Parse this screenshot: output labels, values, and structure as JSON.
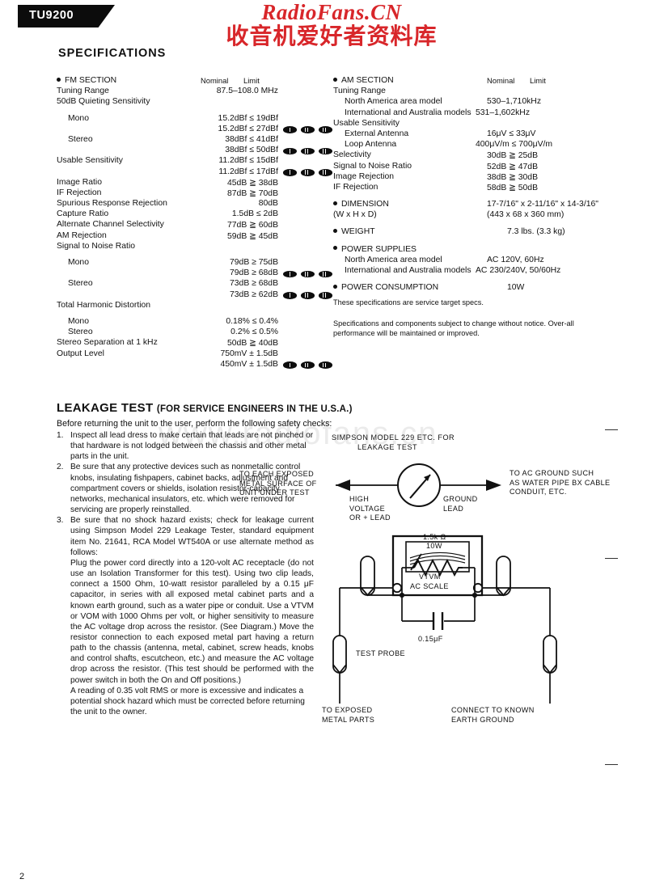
{
  "header": {
    "model": "TU9200",
    "watermark_line1": "RadioFans.CN",
    "watermark_line2": "收音机爱好者资料库",
    "watermark_faint": "www.radiofans.cn"
  },
  "spec_title": "SPECIFICATIONS",
  "fm": {
    "section_label": "FM SECTION",
    "col_nominal": "Nominal",
    "col_limit": "Limit",
    "rows": [
      {
        "label": "Tuning Range",
        "indent": 0,
        "value": "87.5–108.0 MHz",
        "badges": false
      },
      {
        "label": "50dB Quieting Sensitivity",
        "indent": 0,
        "value": "",
        "badges": false
      },
      {
        "label": "Mono",
        "indent": 1,
        "value": "15.2dBf ≤ 19dBf",
        "badges": false
      },
      {
        "label": "",
        "indent": 1,
        "value": "15.2dBf ≤ 27dBf",
        "badges": true
      },
      {
        "label": "Stereo",
        "indent": 1,
        "value": "38dBf ≤ 41dBf",
        "badges": false
      },
      {
        "label": "",
        "indent": 1,
        "value": "38dBf ≤ 50dBf",
        "badges": true
      },
      {
        "label": "Usable Sensitivity",
        "indent": 0,
        "value": "11.2dBf ≤ 15dBf",
        "badges": false
      },
      {
        "label": "",
        "indent": 0,
        "value": "11.2dBf ≤ 17dBf",
        "badges": true
      },
      {
        "label": "Image Ratio",
        "indent": 0,
        "value": "45dB ≧ 38dB",
        "badges": false
      },
      {
        "label": "IF Rejection",
        "indent": 0,
        "value": "87dB ≧ 70dB",
        "badges": false
      },
      {
        "label": "Spurious Response Rejection",
        "indent": 0,
        "value": "80dB",
        "badges": false
      },
      {
        "label": "Capture Ratio",
        "indent": 0,
        "value": "1.5dB ≤ 2dB",
        "badges": false
      },
      {
        "label": "Alternate Channel Selectivity",
        "indent": 0,
        "value": "77dB ≧ 60dB",
        "badges": false
      },
      {
        "label": "AM Rejection",
        "indent": 0,
        "value": "59dB ≧ 45dB",
        "badges": false
      },
      {
        "label": "Signal to Noise Ratio",
        "indent": 0,
        "value": "",
        "badges": false
      },
      {
        "label": "Mono",
        "indent": 1,
        "value": "79dB ≥ 75dB",
        "badges": false
      },
      {
        "label": "",
        "indent": 1,
        "value": "79dB ≥ 68dB",
        "badges": true
      },
      {
        "label": "Stereo",
        "indent": 1,
        "value": "73dB ≥ 68dB",
        "badges": false
      },
      {
        "label": "",
        "indent": 1,
        "value": "73dB ≥ 62dB",
        "badges": true
      },
      {
        "label": "Total Harmonic Distortion",
        "indent": 0,
        "value": "",
        "badges": false
      },
      {
        "label": "Mono",
        "indent": 1,
        "value": "0.18% ≤ 0.4%",
        "badges": false
      },
      {
        "label": "Stereo",
        "indent": 1,
        "value": "0.2% ≤ 0.5%",
        "badges": false
      },
      {
        "label": "Stereo Separation at 1 kHz",
        "indent": 0,
        "value": "50dB ≧ 40dB",
        "badges": false
      },
      {
        "label": "Output Level",
        "indent": 0,
        "value": "750mV ± 1.5dB",
        "badges": false
      },
      {
        "label": "",
        "indent": 0,
        "value": "450mV ± 1.5dB",
        "badges": true
      }
    ]
  },
  "am": {
    "section_label": "AM SECTION",
    "col_nominal": "Nominal",
    "col_limit": "Limit",
    "rows": [
      {
        "label": "Tuning Range",
        "indent": 0,
        "value": ""
      },
      {
        "label": "North America area model",
        "indent": 1,
        "value": "530–1,710kHz"
      },
      {
        "label": "International and Australia models",
        "indent": 1,
        "value": "531–1,602kHz",
        "wide": true
      },
      {
        "label": "Usable Sensitivity",
        "indent": 0,
        "value": ""
      },
      {
        "label": "External Antenna",
        "indent": 1,
        "value": "16μV ≤ 33μV"
      },
      {
        "label": "Loop Antenna",
        "indent": 1,
        "value": "400μV/m ≤ 700μV/m",
        "wide": true
      },
      {
        "label": "Selectivity",
        "indent": 0,
        "value": "30dB ≧ 25dB"
      },
      {
        "label": "Signal to Noise Ratio",
        "indent": 0,
        "value": "52dB ≧ 47dB"
      },
      {
        "label": "Image Rejection",
        "indent": 0,
        "value": "38dB ≧ 30dB"
      },
      {
        "label": "IF Rejection",
        "indent": 0,
        "value": "58dB ≧ 50dB"
      }
    ],
    "blocks": [
      {
        "label": "DIMENSION",
        "sublabel": "(W x H x D)",
        "value": "17-7/16\" x 2-11/16\" x 14-3/16\"",
        "value2": "(443 x 68 x 360 mm)"
      },
      {
        "label": "WEIGHT",
        "value": "7.3 lbs. (3.3 kg)"
      }
    ],
    "power_supplies": {
      "label": "POWER SUPPLIES",
      "rows": [
        {
          "label": "North America area model",
          "value": "AC 120V, 60Hz"
        },
        {
          "label": "International and Australia models",
          "value": "AC 230/240V, 50/60Hz"
        }
      ]
    },
    "power_consumption": {
      "label": "POWER CONSUMPTION",
      "value": "10W"
    },
    "note_1": "These specifications are service target specs.",
    "note_2": "Specifications and components subject to change without notice. Over-all performance will be maintained or improved."
  },
  "leakage": {
    "heading_main": "LEAKAGE TEST",
    "heading_sub": "(FOR SERVICE ENGINEERS IN THE U.S.A.)",
    "intro": "Before returning the unit to the user, perform the following safety checks:",
    "items": [
      {
        "num": "1.",
        "paragraphs": [
          "Inspect all lead dress to make certain that leads are not pinched or that hardware is not lodged between the chassis and other metal parts in the unit."
        ]
      },
      {
        "num": "2.",
        "paragraphs": [
          "Be sure that any protective devices such as nonmetallic control knobs, insulating fishpapers, cabinet backs, adjustment and compartment covers or shields, isolation resistor-capacity networks, mechanical insulators, etc. which were removed for servicing are properly reinstalled."
        ]
      },
      {
        "num": "3.",
        "paragraphs": [
          "Be sure that no shock hazard exists; check for leakage current using Simpson Model 229 Leakage Tester, standard equipment item No. 21641, RCA Model WT540A or use alternate method as follows:",
          "Plug the power cord directly into a 120-volt AC receptacle (do not use an Isolation Transformer for this test). Using two clip leads, connect a 1500 Ohm, 10-watt resistor paralleled by a 0.15 μF capacitor, in series with all exposed metal cabinet parts and a known earth ground, such as a water pipe or conduit. Use a VTVM or VOM with 1000 Ohms per volt, or higher sensitivity to measure the AC voltage drop across the resistor. (See Diagram.) Move the resistor connection to each exposed metal part having a return path to the chassis (antenna, metal, cabinet, screw heads, knobs and control shafts, escutcheon, etc.) and measure the AC voltage drop across the resistor. (This test should be performed with the power switch in both the On and Off positions.)",
          "A reading of 0.35 volt RMS or more is excessive and indicates a potential shock hazard which must be corrected before returning the unit to the owner."
        ]
      }
    ]
  },
  "diagram": {
    "meter_title_line1": "SIMPSON MODEL 229 ETC. FOR",
    "meter_title_line2": "LEAKAGE TEST",
    "left_arrow_label": "TO EACH EXPOSED\nMETAL SURFACE OF\nUNIT UNDER TEST",
    "high_voltage_label": "HIGH\nVOLTAGE\nOR + LEAD",
    "ground_lead_label": "GROUND\nLEAD",
    "right_arrow_label": "TO AC GROUND SUCH\nAS WATER PIPE BX CABLE\nCONDUIT, ETC.",
    "vtvm_label_line1": "VTVM",
    "vtvm_label_line2": "AC SCALE",
    "resistor_label_line1": "1.5k Ω",
    "resistor_label_line2": "10W",
    "capacitor_label": "0.15μF",
    "test_probe_label": "TEST PROBE",
    "bottom_left_label": "TO EXPOSED\nMETAL PARTS",
    "bottom_right_label": "CONNECT TO KNOWN\nEARTH GROUND"
  },
  "page_number": "2"
}
